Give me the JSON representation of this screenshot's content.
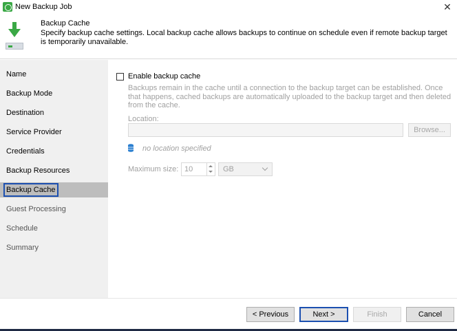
{
  "window": {
    "title": "New Backup Job",
    "close_glyph": "✕"
  },
  "header": {
    "title": "Backup Cache",
    "description": "Specify backup cache settings. Local backup cache allows backups to continue on schedule even if remote backup target is temporarily unavailable."
  },
  "nav": {
    "items": [
      {
        "label": "Name"
      },
      {
        "label": "Backup Mode"
      },
      {
        "label": "Destination"
      },
      {
        "label": "Service Provider"
      },
      {
        "label": "Credentials"
      },
      {
        "label": "Backup Resources"
      },
      {
        "label": "Backup Cache"
      },
      {
        "label": "Guest Processing"
      },
      {
        "label": "Schedule"
      },
      {
        "label": "Summary"
      }
    ],
    "selected": "Backup Cache"
  },
  "content": {
    "enable_label": "Enable backup cache",
    "enable_checked": false,
    "info": "Backups remain in the cache until a connection to the backup target can be established. Once that happens, cached backups are automatically uploaded to the backup target and then deleted from the cache.",
    "location_label": "Location:",
    "location_value": "",
    "browse_label": "Browse...",
    "no_location": "no location specified",
    "max_size_label": "Maximum size:",
    "max_size_value": "10",
    "unit_value": "GB"
  },
  "footer": {
    "previous": "< Previous",
    "next": "Next >",
    "finish": "Finish",
    "cancel": "Cancel"
  },
  "colors": {
    "accent": "#1b4fb0",
    "green": "#3aa845",
    "nav_bg": "#f0f0f0",
    "nav_selected": "#bdbdbd"
  }
}
